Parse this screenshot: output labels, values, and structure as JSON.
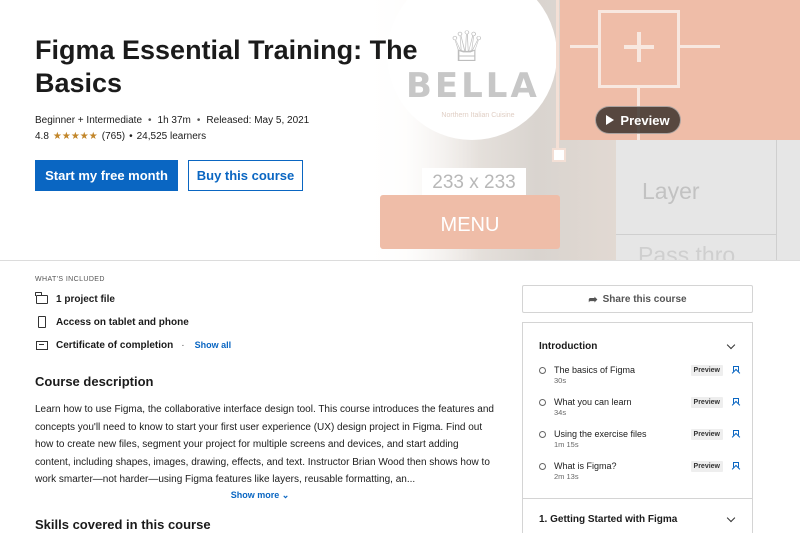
{
  "hero": {
    "title": "Figma Essential Training: The Basics",
    "level": "Beginner + Intermediate",
    "duration": "1h 37m",
    "released": "Released: May 5, 2021",
    "rating": "4.8",
    "stars": "★★★★★",
    "review_count": "(765)",
    "learners": "24,525 learners",
    "primary_cta": "Start my free month",
    "secondary_cta": "Buy this course",
    "preview_label": "Preview",
    "art": {
      "logo_text": "BELLA",
      "logo_sub": "Northern Italian Cuisine",
      "size_label": "233 x 233",
      "menu_label": "MENU",
      "layer_label": "Layer",
      "pass_label": "Pass thro"
    }
  },
  "included": {
    "label": "WHAT'S INCLUDED",
    "items": [
      {
        "icon": "folder-icon",
        "label": "1 project file"
      },
      {
        "icon": "tablet-icon",
        "label": "Access on tablet and phone"
      },
      {
        "icon": "certificate-icon",
        "label": "Certificate of completion"
      }
    ],
    "show_all": "Show all"
  },
  "description": {
    "title": "Course description",
    "body": "Learn how to use Figma, the collaborative interface design tool. This course introduces the features and concepts you'll need to know to start your first user experience (UX) design project in Figma. Find out how to create new files, segment your project for multiple screens and devices, and start adding content, including shapes, images, drawing, effects, and text. Instructor Brian Wood then shows how to work smarter—not harder—using Figma features like layers, reusable formatting, an...",
    "show_more": "Show more"
  },
  "skills": {
    "title": "Skills covered in this course"
  },
  "sidebar": {
    "share_label": "Share this course",
    "sections": [
      {
        "title": "Introduction",
        "lessons": [
          {
            "title": "The basics of Figma",
            "duration": "30s",
            "badge": "Preview"
          },
          {
            "title": "What you can learn",
            "duration": "34s",
            "badge": "Preview"
          },
          {
            "title": "Using the exercise files",
            "duration": "1m 15s",
            "badge": "Preview"
          },
          {
            "title": "What is Figma?",
            "duration": "2m 13s",
            "badge": "Preview"
          }
        ]
      },
      {
        "title": "1. Getting Started with Figma"
      }
    ]
  },
  "colors": {
    "accent": "#0a66c2",
    "star": "#c2862a",
    "art_peach": "#efbda8"
  }
}
